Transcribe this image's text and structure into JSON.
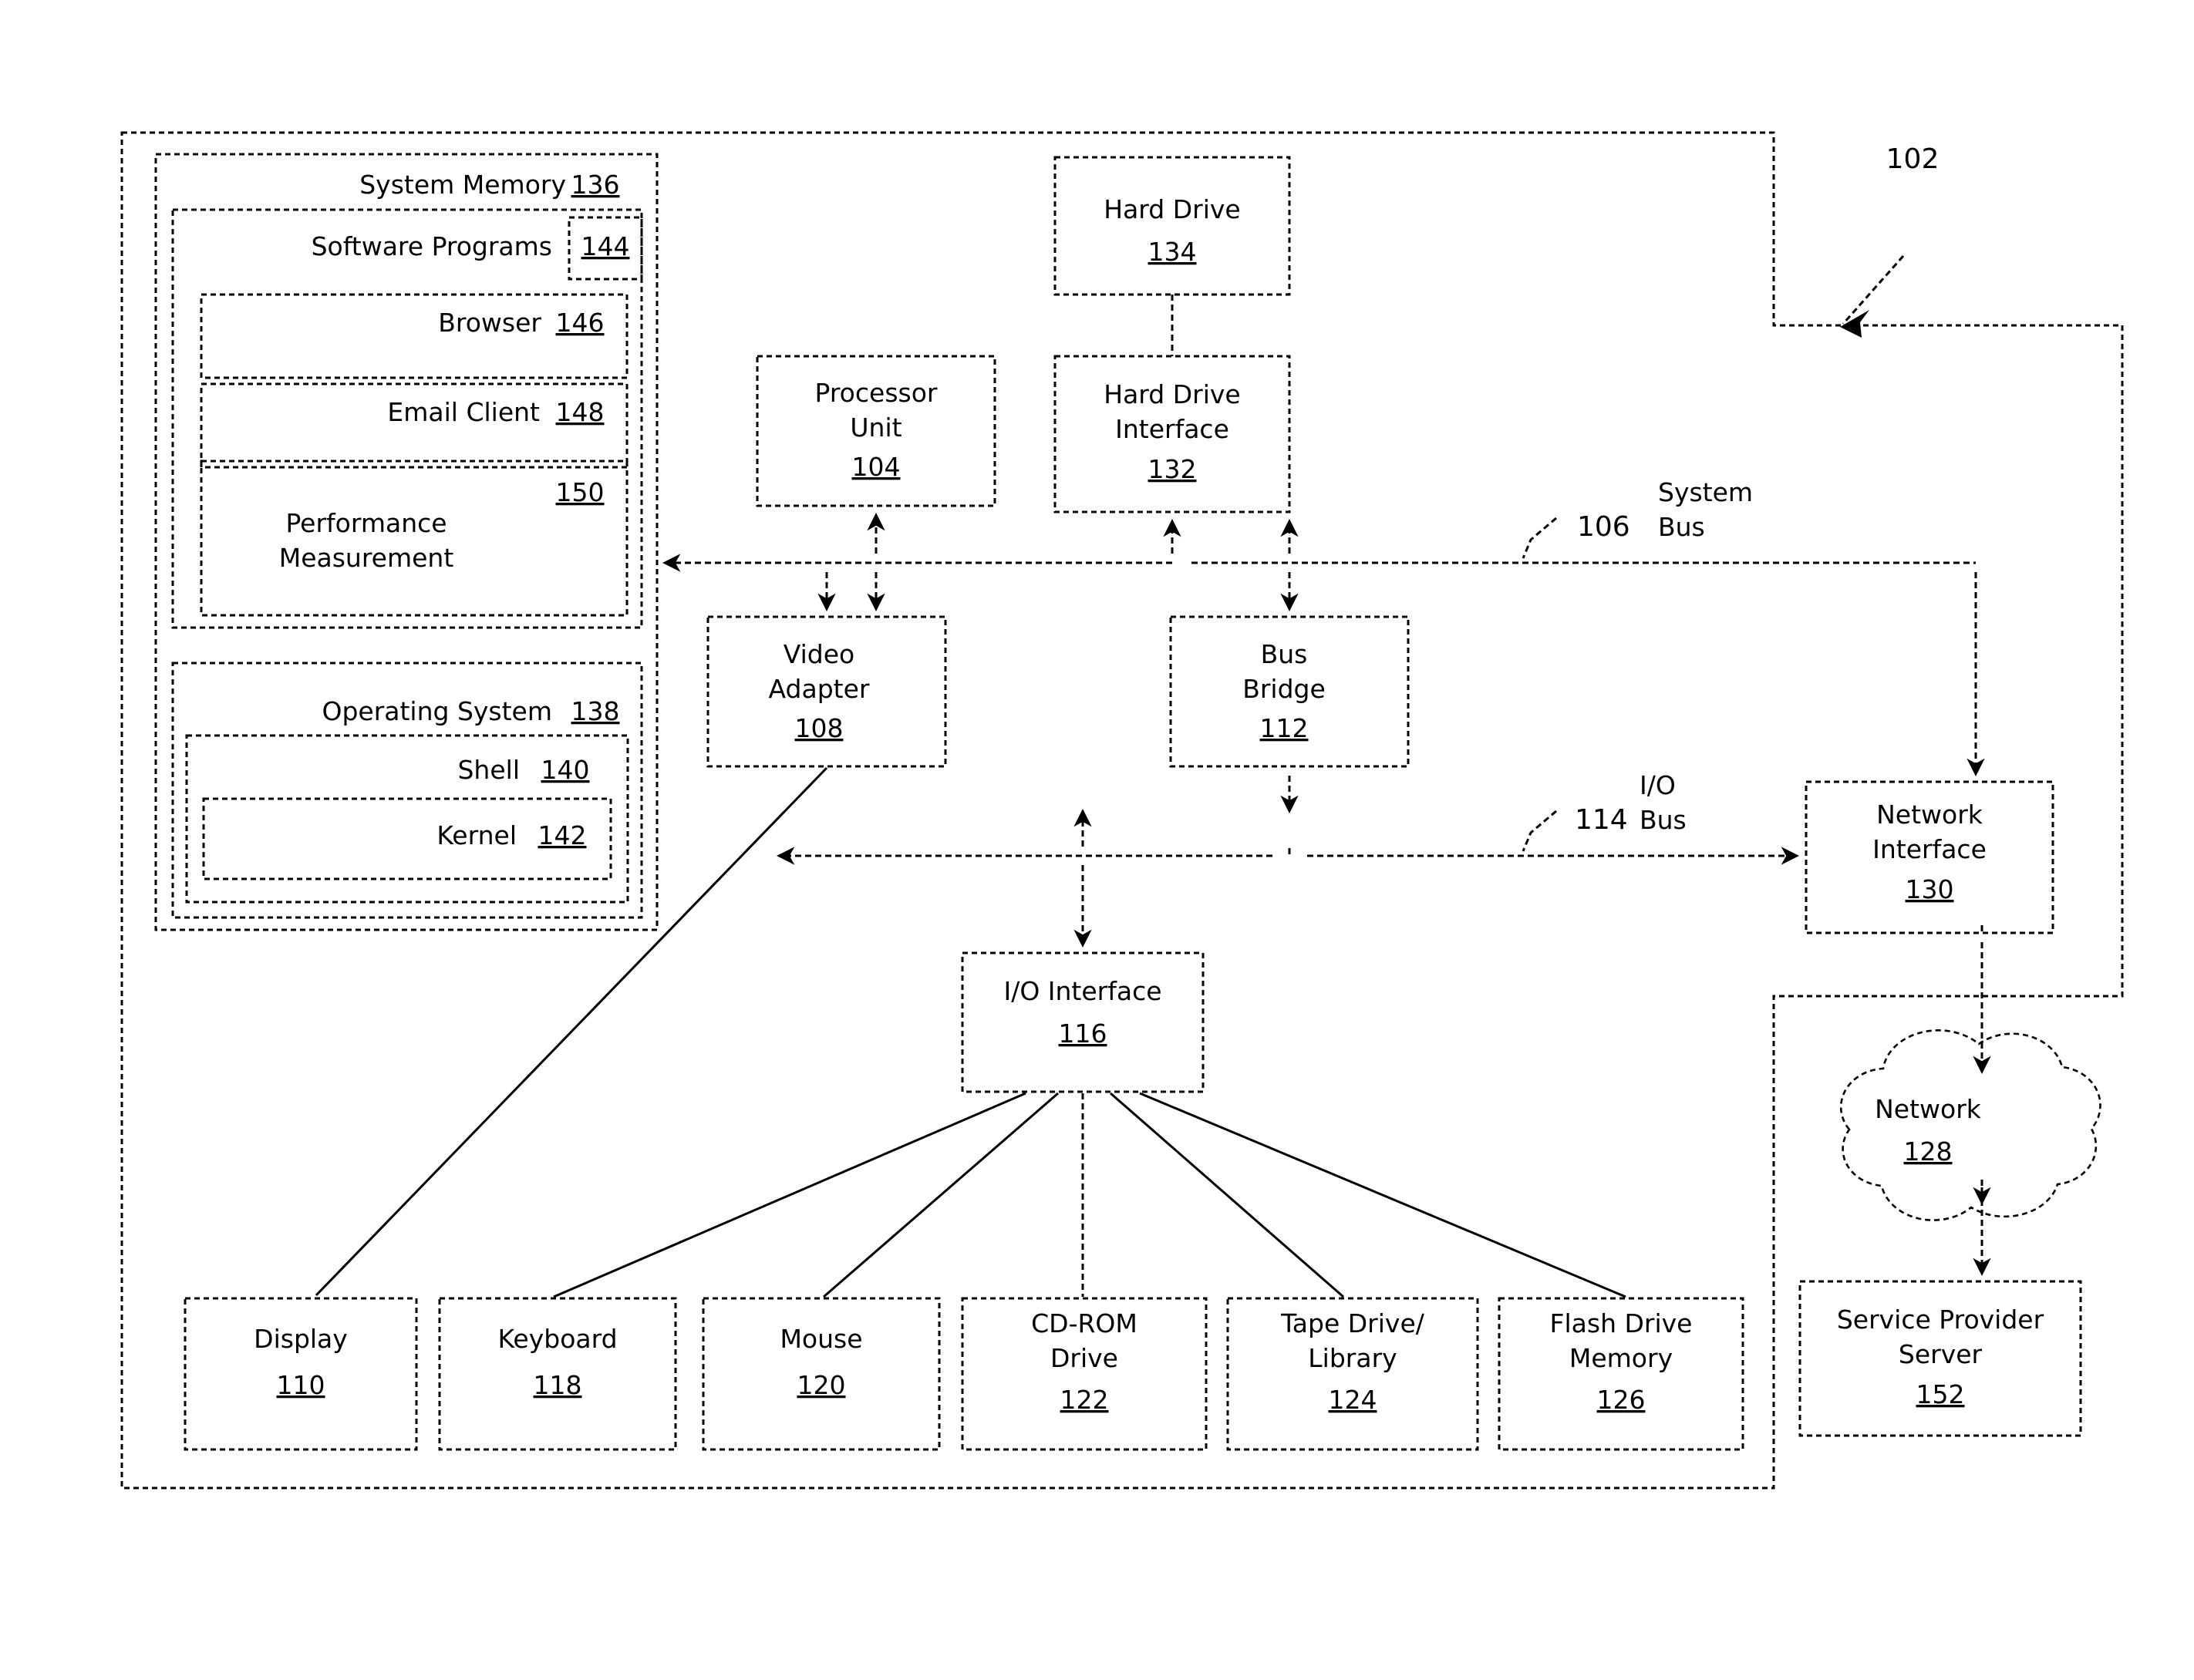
{
  "figure": {
    "root_ref": "102",
    "root_ref_name": "computer-system"
  },
  "buses": {
    "system_bus": {
      "label": "System\nBus",
      "line1": "System",
      "line2": "Bus",
      "ref": "106"
    },
    "io_bus": {
      "label": "I/O\nBus",
      "line1": "I/O",
      "line2": "Bus",
      "ref": "114"
    }
  },
  "system_memory": {
    "title": "System Memory",
    "ref": "136",
    "software_programs": {
      "title": "Software Programs",
      "ref": "144",
      "items": [
        {
          "title": "Browser",
          "ref": "146"
        },
        {
          "title": "Email Client",
          "ref": "148"
        },
        {
          "title": "Performance Measurement",
          "title_line1": "Performance",
          "title_line2": "Measurement",
          "ref": "150"
        }
      ]
    },
    "operating_system": {
      "title": "Operating System",
      "ref": "138",
      "shell": {
        "title": "Shell",
        "ref": "140"
      },
      "kernel": {
        "title": "Kernel",
        "ref": "142"
      }
    }
  },
  "nodes": [
    {
      "name": "hard-drive",
      "line1": "Hard Drive",
      "line2": "",
      "ref": "134"
    },
    {
      "name": "hard-drive-interface",
      "line1": "Hard Drive",
      "line2": "Interface",
      "ref": "132"
    },
    {
      "name": "processor-unit",
      "line1": "Processor",
      "line2": "Unit",
      "ref": "104"
    },
    {
      "name": "video-adapter",
      "line1": "Video",
      "line2": "Adapter",
      "ref": "108"
    },
    {
      "name": "bus-bridge",
      "line1": "Bus",
      "line2": "Bridge",
      "ref": "112"
    },
    {
      "name": "network-interface",
      "line1": "Network",
      "line2": "Interface",
      "ref": "130"
    },
    {
      "name": "io-interface",
      "line1": "I/O Interface",
      "line2": "",
      "ref": "116"
    },
    {
      "name": "network-cloud",
      "line1": "Network",
      "line2": "",
      "ref": "128"
    },
    {
      "name": "service-provider-server",
      "line1": "Service Provider",
      "line2": "Server",
      "ref": "152"
    }
  ],
  "peripherals": [
    {
      "name": "display",
      "line1": "Display",
      "line2": "",
      "ref": "110"
    },
    {
      "name": "keyboard",
      "line1": "Keyboard",
      "line2": "",
      "ref": "118"
    },
    {
      "name": "mouse",
      "line1": "Mouse",
      "line2": "",
      "ref": "120"
    },
    {
      "name": "cd-rom-drive",
      "line1": "CD-ROM",
      "line2": "Drive",
      "ref": "122"
    },
    {
      "name": "tape-drive-library",
      "line1": "Tape Drive/",
      "line2": "Library",
      "ref": "124"
    },
    {
      "name": "flash-drive-memory",
      "line1": "Flash Drive",
      "line2": "Memory",
      "ref": "126"
    }
  ],
  "colors": {
    "ink": "#000000",
    "paper": "#ffffff"
  }
}
